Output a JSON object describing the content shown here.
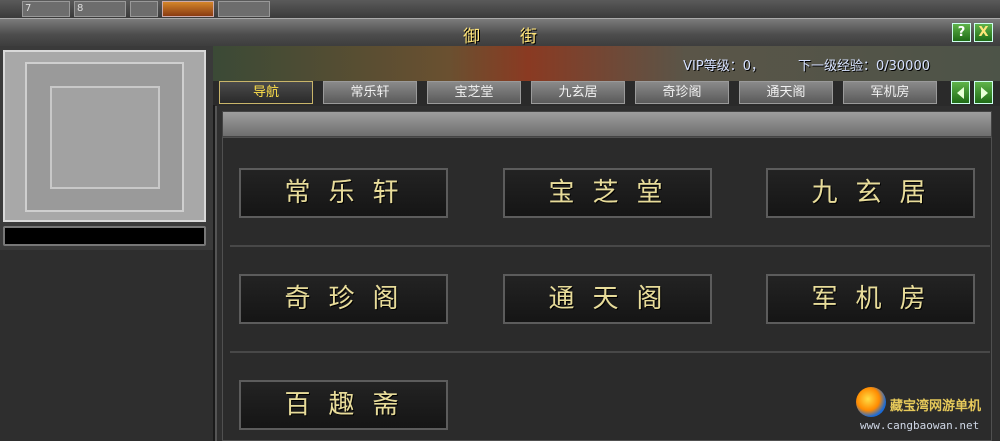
{
  "hotbar": {
    "slots": [
      "7",
      "8",
      "",
      "",
      ""
    ]
  },
  "window": {
    "title": "御街",
    "help_label": "?",
    "close_label": "X"
  },
  "vip": {
    "level_text": "VIP等级：0，",
    "exp_text": "下一级经验：0/30000"
  },
  "tabs": [
    {
      "label": "导航",
      "active": true
    },
    {
      "label": "常乐轩",
      "active": false
    },
    {
      "label": "宝芝堂",
      "active": false
    },
    {
      "label": "九玄居",
      "active": false
    },
    {
      "label": "奇珍阁",
      "active": false
    },
    {
      "label": "通天阁",
      "active": false
    },
    {
      "label": "军机房",
      "active": false
    }
  ],
  "shops": [
    {
      "label": "常乐轩"
    },
    {
      "label": "宝芝堂"
    },
    {
      "label": "九玄居"
    },
    {
      "label": "奇珍阁"
    },
    {
      "label": "通天阁"
    },
    {
      "label": "军机房"
    },
    {
      "label": "百趣斋"
    }
  ],
  "watermark": {
    "name": "藏宝湾网游单机",
    "url": "www.cangbaowan.net"
  },
  "icons": {
    "tab_prev": "chevron-left-icon",
    "tab_next": "chevron-right-icon"
  }
}
